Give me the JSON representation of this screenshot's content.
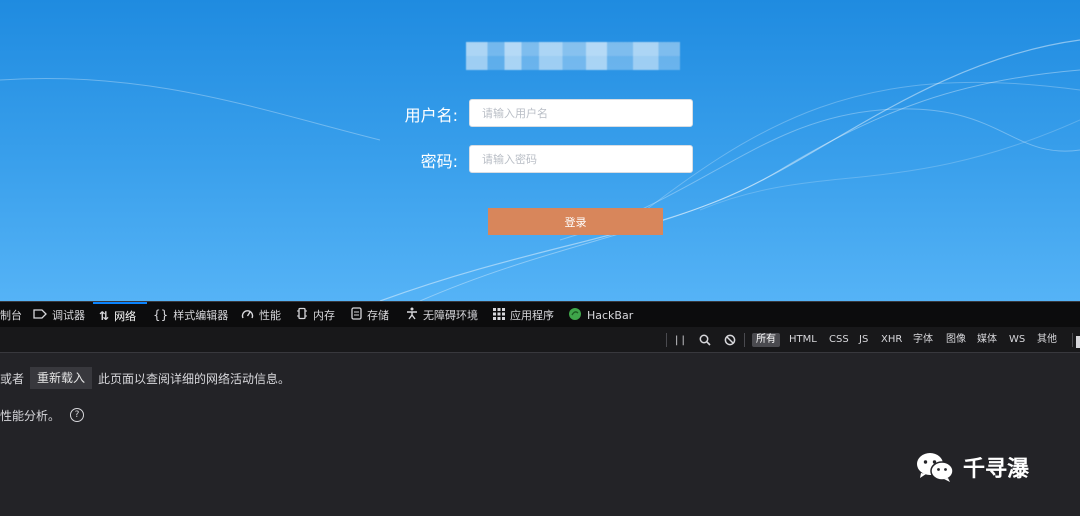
{
  "login": {
    "username_label": "用户名:",
    "username_placeholder": "请输入用户名",
    "password_label": "密码:",
    "password_placeholder": "请输入密码",
    "login_button": "登录"
  },
  "devtools": {
    "tabs": [
      {
        "label": "制台",
        "icon": "console-icon"
      },
      {
        "label": "调试器",
        "icon": "debugger-icon"
      },
      {
        "label": "网络",
        "icon": "network-icon",
        "active": true
      },
      {
        "label": "样式编辑器",
        "icon": "braces-icon"
      },
      {
        "label": "性能",
        "icon": "gauge-icon"
      },
      {
        "label": "内存",
        "icon": "memory-chip-icon"
      },
      {
        "label": "存储",
        "icon": "storage-icon"
      },
      {
        "label": "无障碍环境",
        "icon": "accessibility-icon"
      },
      {
        "label": "应用程序",
        "icon": "grid-icon"
      },
      {
        "label": "HackBar",
        "icon": "hackbar-icon"
      }
    ],
    "toolbar": {
      "pause": "| |",
      "filters": [
        "所有",
        "HTML",
        "CSS",
        "JS",
        "XHR",
        "字体",
        "图像",
        "媒体",
        "WS",
        "其他"
      ],
      "active_filter": "所有"
    },
    "message": {
      "prefix": "或者",
      "reload_button": "重新载入",
      "suffix": "此页面以查阅详细的网络活动信息。",
      "perf_text": "性能分析。",
      "help": "?"
    },
    "active_color": "#0a84ff"
  },
  "watermark": {
    "text": "千寻瀑"
  }
}
